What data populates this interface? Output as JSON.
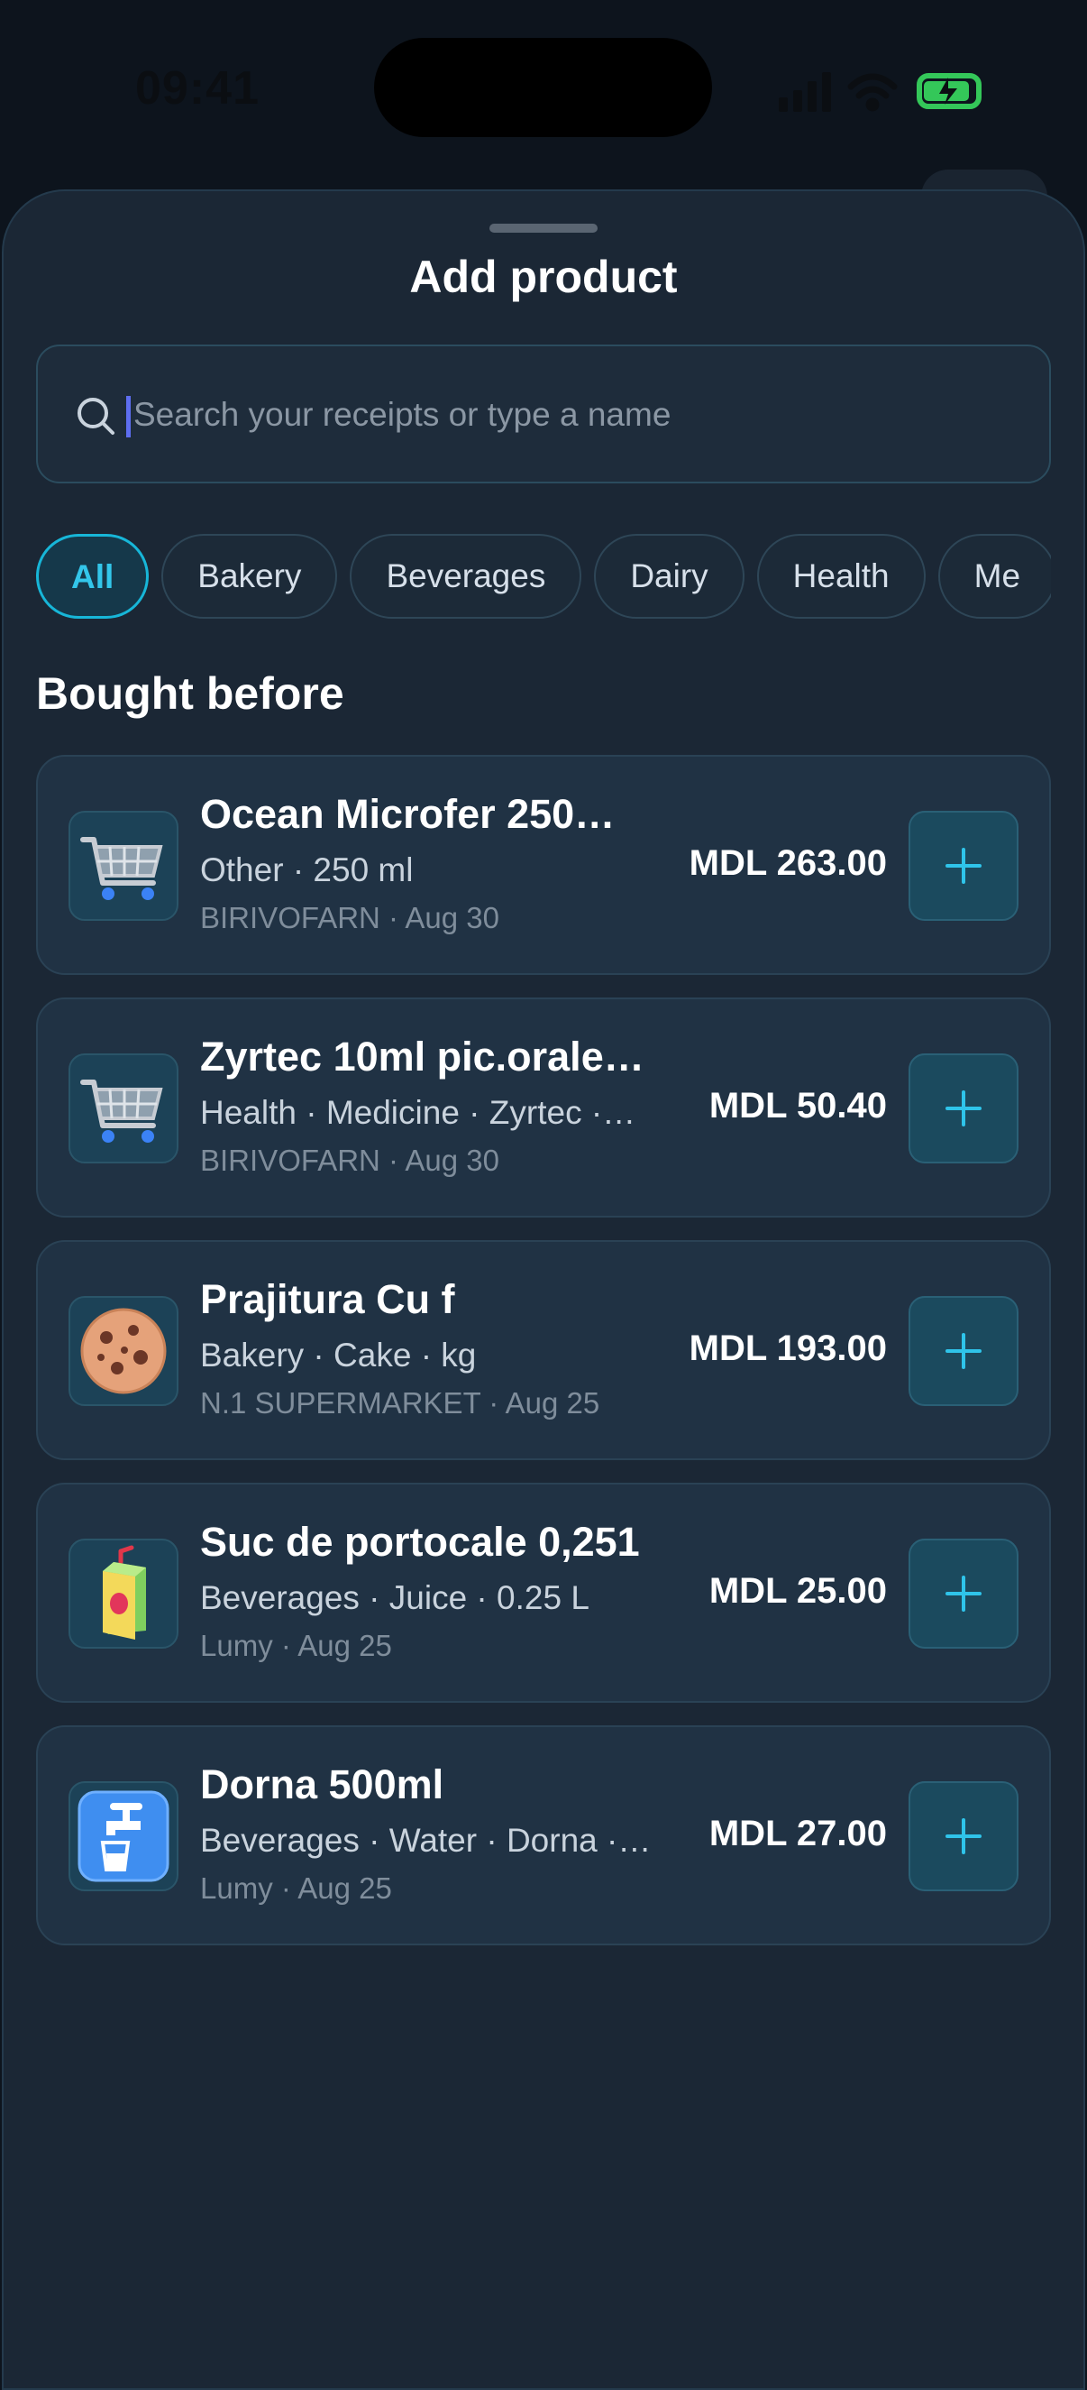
{
  "status": {
    "time": "09:41"
  },
  "sheet": {
    "title": "Add product",
    "search": {
      "placeholder": "Search your receipts or type a name",
      "value": ""
    },
    "filters": [
      "All",
      "Bakery",
      "Beverages",
      "Dairy",
      "Health",
      "Me"
    ],
    "active_filter": "All",
    "section_title": "Bought before",
    "products": [
      {
        "name": "Ocean Microfer 250…",
        "meta": "Other · 250 ml",
        "store": "BIRIVOFARN · Aug 30",
        "price": "MDL 263.00",
        "icon": "shopping-cart-icon"
      },
      {
        "name": "Zyrtec 10ml pic.orale…",
        "meta": "Health · Medicine · Zyrtec ·…",
        "store": "BIRIVOFARN · Aug 30",
        "price": "MDL 50.40",
        "icon": "shopping-cart-icon"
      },
      {
        "name": "Prajitura Cu f",
        "meta": "Bakery · Cake · kg",
        "store": "N.1 SUPERMARKET · Aug 25",
        "price": "MDL 193.00",
        "icon": "cookie-icon"
      },
      {
        "name": "Suc de portocale 0,251",
        "meta": "Beverages · Juice · 0.25 L",
        "store": "Lumy · Aug 25",
        "price": "MDL 25.00",
        "icon": "juice-box-icon"
      },
      {
        "name": "Dorna 500ml",
        "meta": "Beverages · Water · Dorna ·…",
        "store": "Lumy · Aug 25",
        "price": "MDL 27.00",
        "icon": "water-tap-icon"
      }
    ]
  },
  "colors": {
    "accent": "#17b6d8",
    "sheet_bg": "#1b2735",
    "card_bg": "#203244",
    "battery": "#34c759"
  }
}
